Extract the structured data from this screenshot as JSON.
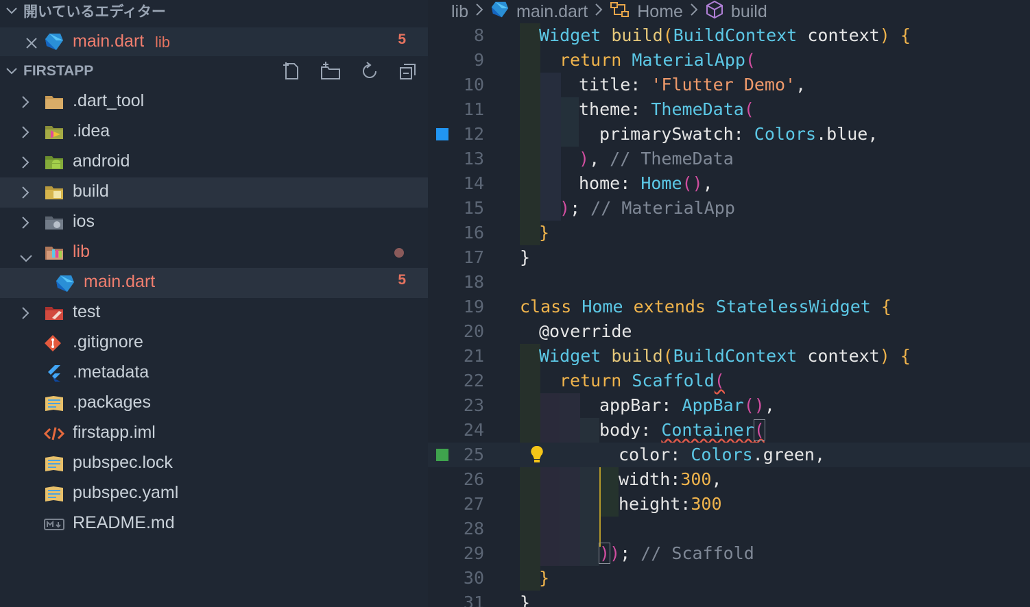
{
  "sidebar": {
    "open_editors_title": "開いているエディター",
    "open_editor": {
      "name": "main.dart",
      "folder": "lib",
      "problems": "5"
    },
    "project_title": "FIRSTAPP",
    "tree": [
      {
        "name": ".dart_tool",
        "icon": "folder-icon",
        "kind": "folder"
      },
      {
        "name": ".idea",
        "icon": "idea-folder-icon",
        "kind": "folder"
      },
      {
        "name": "android",
        "icon": "android-folder-icon",
        "kind": "folder"
      },
      {
        "name": "build",
        "icon": "build-folder-icon",
        "kind": "folder"
      },
      {
        "name": "ios",
        "icon": "ios-folder-icon",
        "kind": "folder"
      },
      {
        "name": "lib",
        "icon": "lib-folder-icon",
        "kind": "folder-open"
      },
      {
        "name": "main.dart",
        "icon": "dart-file-icon",
        "kind": "file",
        "problems": "5"
      },
      {
        "name": "test",
        "icon": "test-folder-icon",
        "kind": "folder"
      },
      {
        "name": ".gitignore",
        "icon": "git-icon",
        "kind": "file"
      },
      {
        "name": ".metadata",
        "icon": "flutter-icon",
        "kind": "file"
      },
      {
        "name": ".packages",
        "icon": "yaml-icon",
        "kind": "file"
      },
      {
        "name": "firstapp.iml",
        "icon": "xml-icon",
        "kind": "file"
      },
      {
        "name": "pubspec.lock",
        "icon": "yaml-icon",
        "kind": "file"
      },
      {
        "name": "pubspec.yaml",
        "icon": "yaml-icon",
        "kind": "file"
      },
      {
        "name": "README.md",
        "icon": "markdown-icon",
        "kind": "file"
      }
    ]
  },
  "breadcrumb": {
    "folder": "lib",
    "file": "main.dart",
    "class": "Home",
    "method": "build"
  },
  "code_lines": [
    {
      "n": "8"
    },
    {
      "n": "9"
    },
    {
      "n": "10"
    },
    {
      "n": "11"
    },
    {
      "n": "12"
    },
    {
      "n": "13"
    },
    {
      "n": "14"
    },
    {
      "n": "15"
    },
    {
      "n": "16"
    },
    {
      "n": "17"
    },
    {
      "n": "18"
    },
    {
      "n": "19"
    },
    {
      "n": "20"
    },
    {
      "n": "21"
    },
    {
      "n": "22"
    },
    {
      "n": "23"
    },
    {
      "n": "24"
    },
    {
      "n": "25"
    },
    {
      "n": "26"
    },
    {
      "n": "27"
    },
    {
      "n": "28"
    },
    {
      "n": "29"
    },
    {
      "n": "30"
    },
    {
      "n": "31"
    }
  ],
  "colors": {
    "accent_error": "#f07e6e",
    "modified_blue": "#2196f3",
    "added_green": "#3fa34d"
  }
}
